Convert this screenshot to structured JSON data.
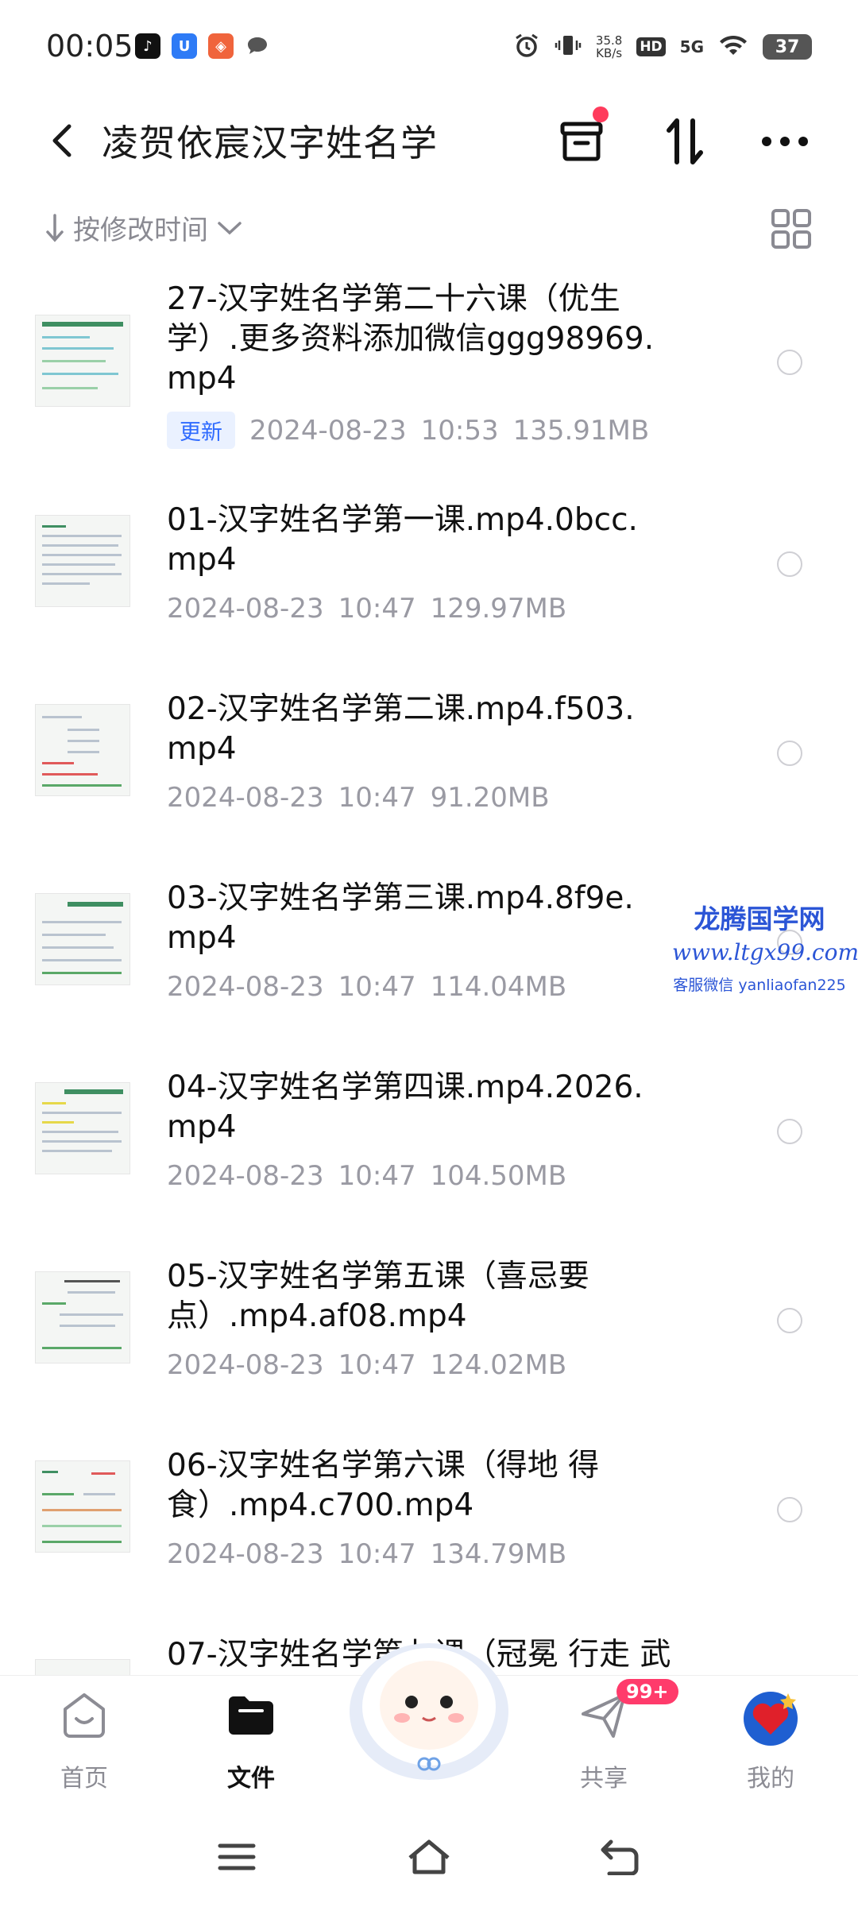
{
  "status_bar": {
    "time": "00:05",
    "net_speed_value": "35.8",
    "net_speed_unit": "KB/s",
    "hd": "HD",
    "network": "5G",
    "battery": "37"
  },
  "header": {
    "title": "凌贺依宸汉字姓名学"
  },
  "sort_bar": {
    "label": "按修改时间"
  },
  "files": [
    {
      "name": "27-汉字姓名学第二十六课（优生学）.更多资料添加微信ggg98969.mp4",
      "badge": "更新",
      "date": "2024-08-23",
      "time": "10:53",
      "size": "135.91MB"
    },
    {
      "name": "01-汉字姓名学第一课.mp4.0bcc.mp4",
      "date": "2024-08-23",
      "time": "10:47",
      "size": "129.97MB"
    },
    {
      "name": "02-汉字姓名学第二课.mp4.f503.mp4",
      "date": "2024-08-23",
      "time": "10:47",
      "size": "91.20MB"
    },
    {
      "name": "03-汉字姓名学第三课.mp4.8f9e.mp4",
      "date": "2024-08-23",
      "time": "10:47",
      "size": "114.04MB"
    },
    {
      "name": "04-汉字姓名学第四课.mp4.2026.mp4",
      "date": "2024-08-23",
      "time": "10:47",
      "size": "104.50MB"
    },
    {
      "name": "05-汉字姓名学第五课（喜忌要点）.mp4.af08.mp4",
      "date": "2024-08-23",
      "time": "10:47",
      "size": "124.02MB"
    },
    {
      "name": "06-汉字姓名学第六课（得地 得食）.mp4.c700.mp4",
      "date": "2024-08-23",
      "time": "10:47",
      "size": "134.79MB"
    },
    {
      "name": "07-汉字姓名学第七课（冠冕 行走 武"
    }
  ],
  "watermark": {
    "title": "龙腾国学网",
    "url": "www.ltgx99.com",
    "contact": "客服微信 yanliaofan225"
  },
  "bottom_nav": {
    "home": "首页",
    "files": "文件",
    "share": "共享",
    "share_badge": "99+",
    "mine": "我的"
  },
  "colors": {
    "accent_blue": "#2f6bff",
    "badge_red": "#ff3b6b",
    "secondary_text": "#9a9aa3"
  }
}
